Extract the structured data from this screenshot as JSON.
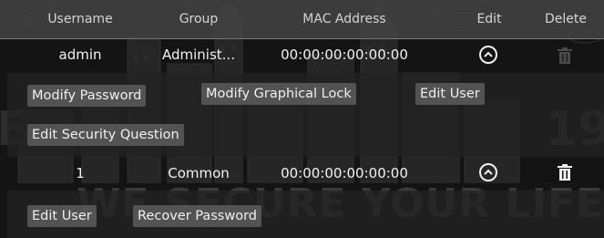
{
  "watermark": {
    "slogan": "WE SECURE YOUR LIFE",
    "number_fragment": "19",
    "left_fragment": "E."
  },
  "table": {
    "columns": [
      "Username",
      "Group",
      "MAC Address",
      "Edit",
      "Delete"
    ],
    "rows": [
      {
        "username": "admin",
        "group": "Administ...",
        "mac": "00:00:00:00:00:00",
        "delete_enabled": false,
        "actions": [
          "Modify Password",
          "Modify Graphical Lock",
          "Edit User",
          "Edit Security Question"
        ]
      },
      {
        "username": "1",
        "group": "Common",
        "mac": "00:00:00:00:00:00",
        "delete_enabled": true,
        "actions": [
          "Edit User",
          "Recover Password"
        ]
      }
    ]
  },
  "icons": {
    "collapse": "chevron-up-circle-icon",
    "delete": "trash-icon"
  },
  "colors": {
    "background": "#141414",
    "header": "#464646",
    "button": "#585858",
    "text": "#f0f0f0",
    "disabled_icon": "#4a4a4a"
  }
}
